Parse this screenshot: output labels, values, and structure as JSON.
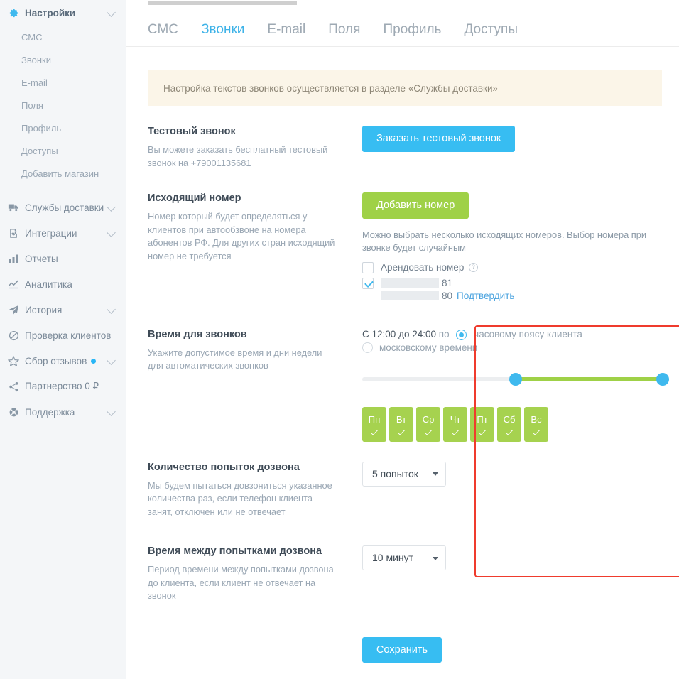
{
  "sidebar": {
    "groups": [
      {
        "icon": "gear-icon",
        "label": "Настройки",
        "expandable": true,
        "active": true,
        "children": [
          {
            "label": "СМС"
          },
          {
            "label": "Звонки"
          },
          {
            "label": "E-mail"
          },
          {
            "label": "Поля"
          },
          {
            "label": "Профиль"
          },
          {
            "label": "Доступы"
          },
          {
            "label": "Добавить магазин"
          }
        ]
      },
      {
        "icon": "truck-icon",
        "label": "Службы доставки",
        "expandable": true
      },
      {
        "icon": "puzzle-icon",
        "label": "Интеграции",
        "expandable": true
      },
      {
        "icon": "bar-chart-icon",
        "label": "Отчеты",
        "expandable": false
      },
      {
        "icon": "line-chart-icon",
        "label": "Аналитика",
        "expandable": false
      },
      {
        "icon": "paper-plane-icon",
        "label": "История",
        "expandable": true
      },
      {
        "icon": "ban-icon",
        "label": "Проверка клиентов",
        "expandable": false
      },
      {
        "icon": "star-icon",
        "label": "Сбор отзывов",
        "expandable": true,
        "dot": true
      },
      {
        "icon": "share-icon",
        "label": "Партнерство 0 ₽",
        "expandable": false
      },
      {
        "icon": "lifebuoy-icon",
        "label": "Поддержка",
        "expandable": true
      }
    ]
  },
  "tabs": [
    {
      "label": "СМС",
      "active": false
    },
    {
      "label": "Звонки",
      "active": true
    },
    {
      "label": "E-mail",
      "active": false
    },
    {
      "label": "Поля",
      "active": false
    },
    {
      "label": "Профиль",
      "active": false
    },
    {
      "label": "Доступы",
      "active": false
    }
  ],
  "notice": {
    "text": "Настройка текстов звонков осуществляется в разделе «Службы доставки»"
  },
  "test_call": {
    "title": "Тестовый звонок",
    "description": "Вы можете заказать бесплатный тестовый звонок на +79001135681",
    "button_label": "Заказать тестовый звонок"
  },
  "outgoing_number": {
    "title": "Исходящий номер",
    "description": "Номер который будет определяться у клиентов при автообзвоне на номера абонентов РФ. Для других стран исходящий номер не требуется",
    "button_label": "Добавить номер",
    "hint": "Можно выбрать несколько исходящих номеров. Выбор номера при звонке будет случайным",
    "rent_checkbox_label": "Арендовать номер",
    "rent_checked": false,
    "numbers": [
      {
        "masked": true,
        "suffix": "81",
        "checked": true,
        "action": ""
      },
      {
        "masked": true,
        "suffix": "80",
        "checked": false,
        "action": "Подтвердить"
      }
    ]
  },
  "call_time": {
    "title": "Время для звонков",
    "description": "Укажите допустимое время и дни недели для автоматических звонков",
    "range_prefix": "С",
    "time_from": "12:00",
    "time_to_word": "до",
    "time_to": "24:00",
    "by_word": "по",
    "option_client_tz": "часовому поясу клиента",
    "option_moscow": "московскому времени",
    "selected_option": "часовому поясу клиента",
    "slider": {
      "min_percent": 50,
      "max_percent": 100
    },
    "days": [
      {
        "label": "Пн",
        "checked": true
      },
      {
        "label": "Вт",
        "checked": true
      },
      {
        "label": "Ср",
        "checked": true
      },
      {
        "label": "Чт",
        "checked": true
      },
      {
        "label": "Пт",
        "checked": true
      },
      {
        "label": "Сб",
        "checked": true
      },
      {
        "label": "Вс",
        "checked": true
      }
    ]
  },
  "attempts": {
    "title": "Количество попыток дозвона",
    "description": "Мы будем пытаться довзониться указанное количества раз, если телефон клиента занят, отключен или не отвечает",
    "value": "5 попыток"
  },
  "interval": {
    "title": "Время между попытками дозвона",
    "description": "Период времени между попытками дозвона до клиента, если клиент не отвечает на звонок",
    "value": "10 минут"
  },
  "save": {
    "label": "Сохранить"
  },
  "colors": {
    "accent_blue": "#37bdf2",
    "accent_green": "#9fd147",
    "highlight_red": "#ef3b2d",
    "notice_bg": "#fbf5e8",
    "sidebar_bg": "#f4f6f8"
  }
}
